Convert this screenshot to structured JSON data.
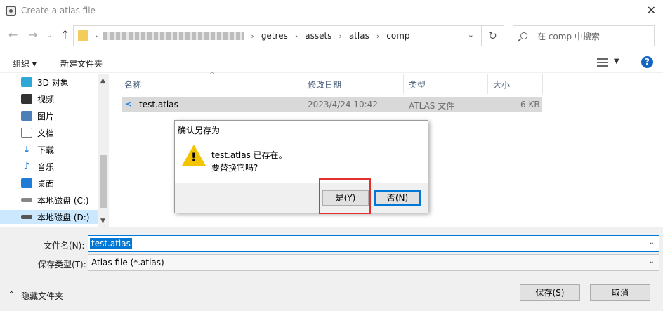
{
  "window": {
    "title": "Create a atlas file",
    "close_icon": "close-icon"
  },
  "nav": {
    "breadcrumbs": [
      "getres",
      "assets",
      "atlas",
      "comp"
    ],
    "search_placeholder": "在 comp 中搜索"
  },
  "toolbar": {
    "organize": "组织 ▾",
    "new_folder": "新建文件夹",
    "help": "?"
  },
  "sidebar": {
    "items": [
      {
        "label": "3D 对象",
        "icon": "3d-objects-icon",
        "color": "#2fa8d8"
      },
      {
        "label": "视频",
        "icon": "video-icon",
        "color": "#333333"
      },
      {
        "label": "图片",
        "icon": "picture-icon",
        "color": "#4a7fb8"
      },
      {
        "label": "文档",
        "icon": "document-icon",
        "color": "#777777"
      },
      {
        "label": "下载",
        "icon": "download-icon",
        "color": "#1e7bd6"
      },
      {
        "label": "音乐",
        "icon": "music-icon",
        "color": "#1e7bd6"
      },
      {
        "label": "桌面",
        "icon": "desktop-icon",
        "color": "#1e7bd6"
      },
      {
        "label": "本地磁盘 (C:)",
        "icon": "drive-icon",
        "color": "#666666"
      },
      {
        "label": "本地磁盘 (D:)",
        "icon": "drive-icon",
        "color": "#666666"
      }
    ]
  },
  "table": {
    "columns": [
      "名称",
      "修改日期",
      "类型",
      "大小"
    ],
    "rows": [
      {
        "name": "test.atlas",
        "date": "2023/4/24 10:42",
        "type": "ATLAS 文件",
        "size": "6 KB"
      }
    ]
  },
  "bottom": {
    "filename_label": "文件名(N):",
    "filename_value": "test.atlas",
    "filetype_label": "保存类型(T):",
    "filetype_value": "Atlas file (*.atlas)",
    "hide_folders": "隐藏文件夹",
    "save": "保存(S)",
    "cancel": "取消"
  },
  "modal": {
    "title": "确认另存为",
    "line1": "test.atlas 已存在。",
    "line2": "要替换它吗?",
    "yes": "是(Y)",
    "no": "否(N)"
  }
}
